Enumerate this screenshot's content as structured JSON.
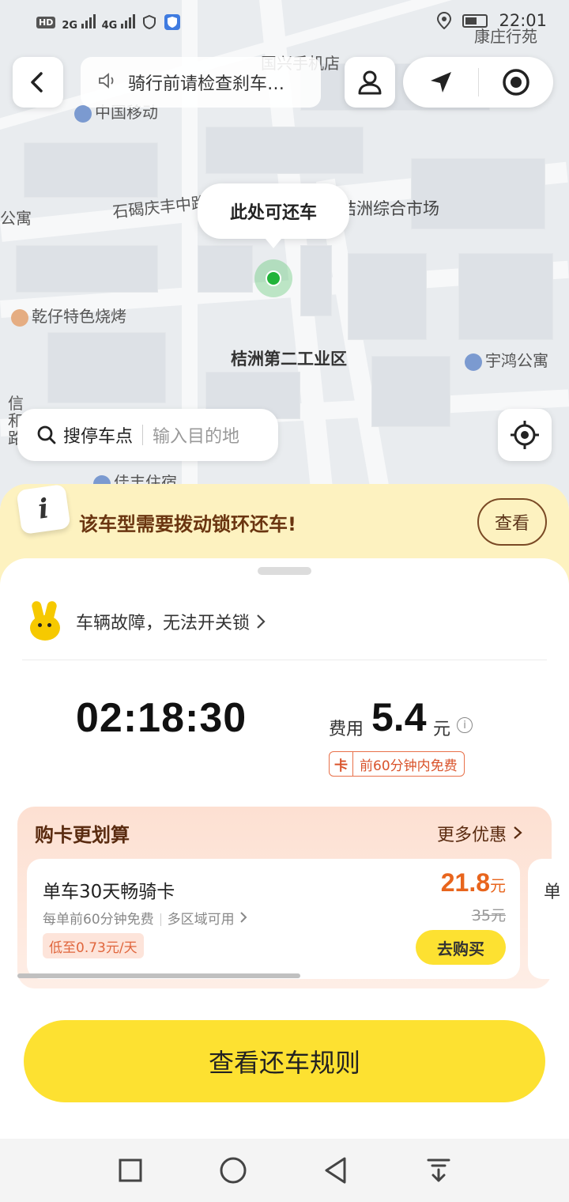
{
  "status_bar": {
    "hd": "HD",
    "net1": "2G",
    "net2": "4G",
    "time": "22:01"
  },
  "map": {
    "labels": {
      "kangzhuang": "康庄行苑",
      "guoxing": "国兴手机店",
      "china_mobile": "中国移动",
      "road": "石碣庆丰中路",
      "market": "桔洲综合市场",
      "gongyu": "公寓",
      "bbq": "乾仔特色烧烤",
      "industrial": "桔洲第二工业区",
      "yuhong": "宇鸿公寓",
      "xin": "信",
      "he": "和",
      "lu": "路",
      "jiafeng": "佳丰住宿"
    },
    "return_bubble": "此处可还车"
  },
  "top": {
    "notice": "骑行前请检查刹车…"
  },
  "search": {
    "label": "搜停车点",
    "placeholder": "输入目的地"
  },
  "tip": {
    "text": "该车型需要拨动锁环还车!",
    "view_label": "查看"
  },
  "ride": {
    "fault_text": "车辆故障，无法开关锁",
    "timer": "02:18:30",
    "fee_label": "费用",
    "fee_value": "5.4",
    "fee_unit": "元",
    "free_tag_k": "卡",
    "free_tag_text": "前60分钟内免费"
  },
  "promo": {
    "title": "购卡更划算",
    "more": "更多优惠",
    "pass": {
      "name": "单车30天畅骑卡",
      "desc1": "每单前60分钟免费",
      "desc2": "多区域可用",
      "tag": "低至0.73元/天",
      "price": "21.8",
      "price_unit": "元",
      "original": "35元",
      "buy": "去购买"
    },
    "next_card_peek": "单",
    "scroll_progress": 0.53
  },
  "rules_button": "查看还车规则",
  "colors": {
    "brand_yellow": "#fde131",
    "price_orange": "#e8651d",
    "tip_bg": "#fdf2c0",
    "loc_green": "#22b43a"
  },
  "icons": {
    "back": "back-arrow-icon",
    "speaker": "speaker-icon",
    "user": "user-icon",
    "navigate": "navigate-arrow-icon",
    "target": "target-icon",
    "locate": "locate-crosshair-icon",
    "search": "search-icon"
  }
}
